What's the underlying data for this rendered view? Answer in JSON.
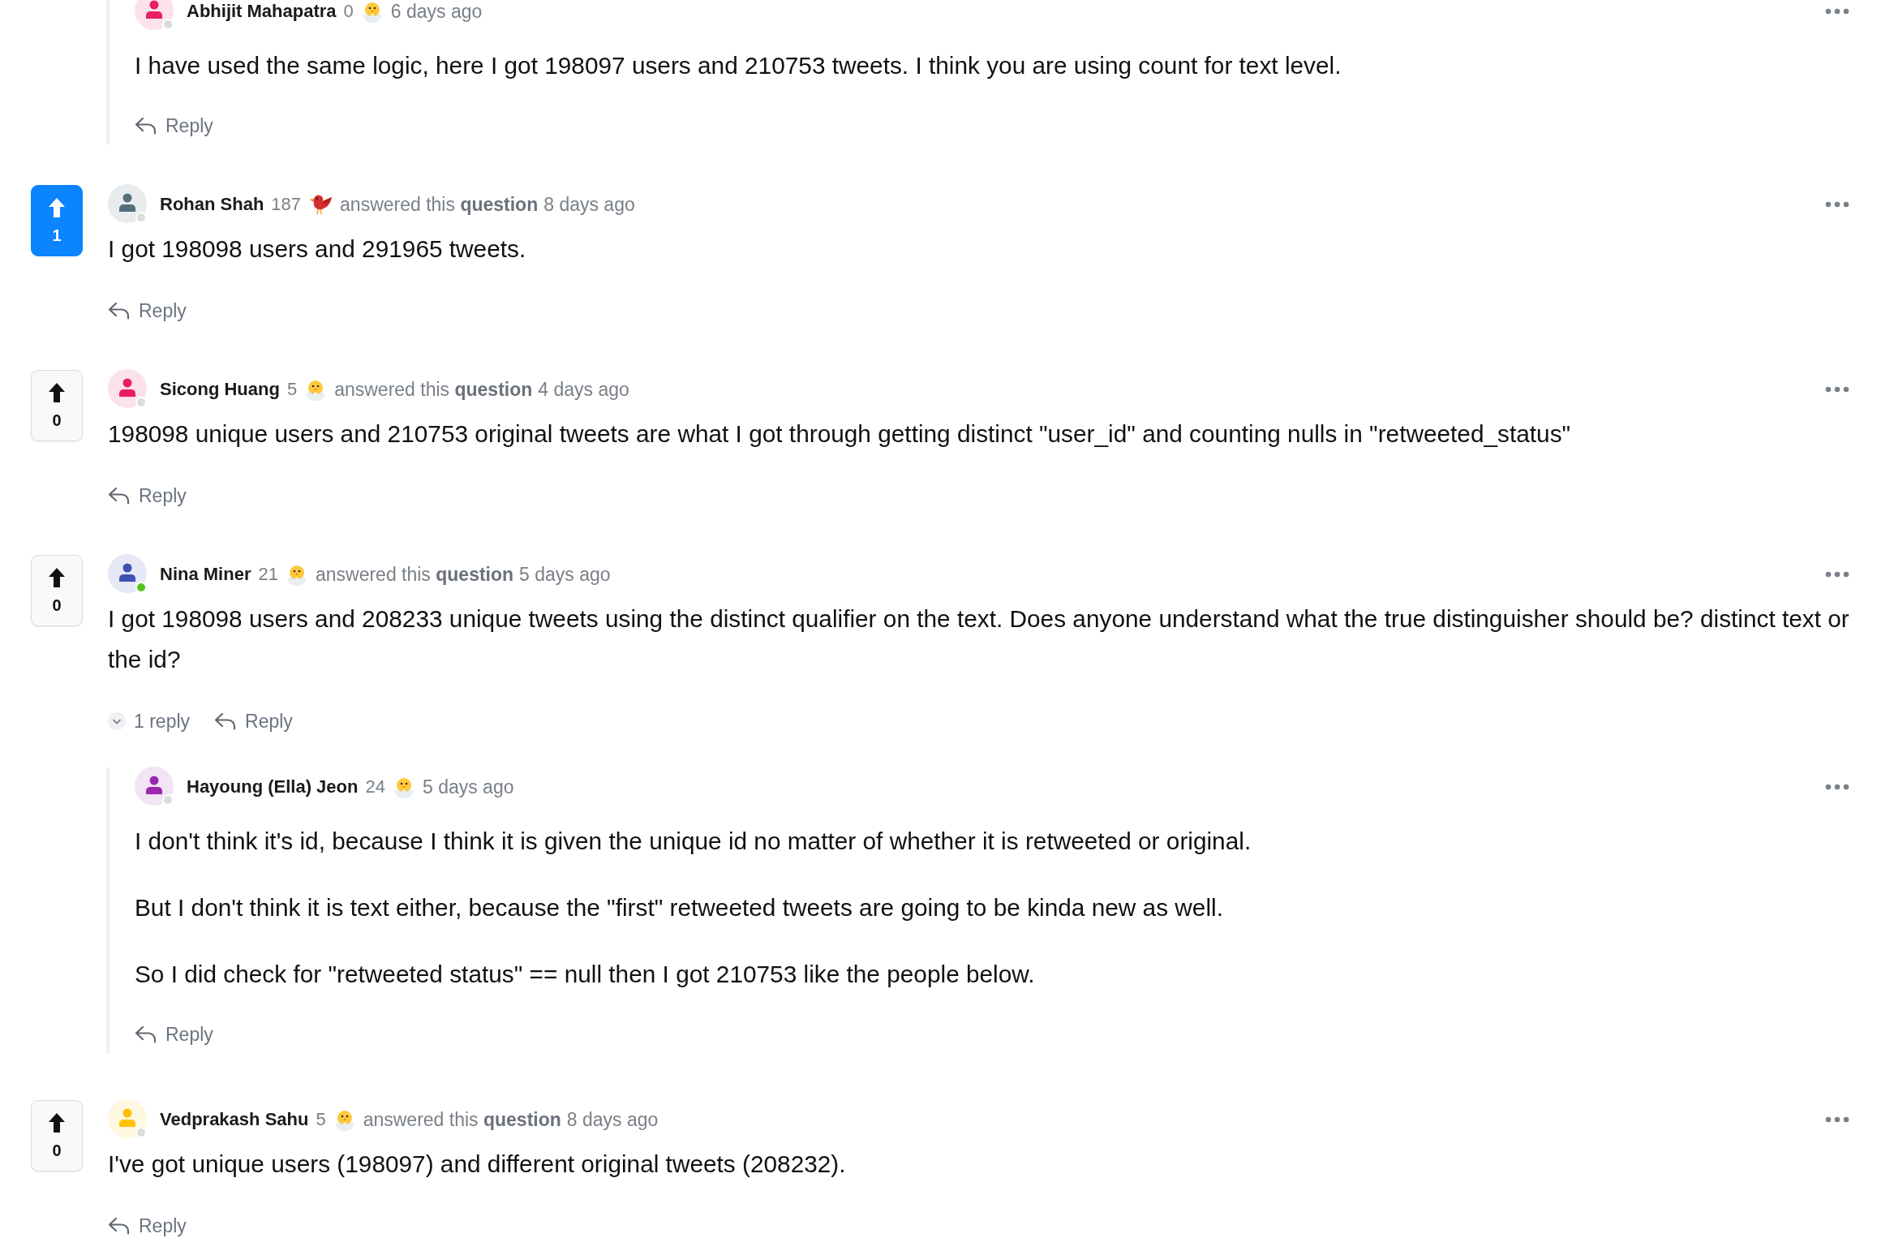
{
  "thread_continuation": {
    "replies": [
      {
        "author": {
          "name": "Abhijit Mahapatra",
          "score": "0",
          "badge": {
            "kind": "chick"
          },
          "avatar": {
            "color": "#e91e63",
            "online": false
          }
        },
        "time": "6 days ago",
        "paragraphs": [
          "I have used the same logic, here I got 198097 users and 210753 tweets. I think  you are using count for text level."
        ],
        "reply_label": "Reply"
      }
    ]
  },
  "answers": [
    {
      "votes": {
        "count": "1",
        "upvoted": true
      },
      "author": {
        "name": "Rohan Shah",
        "score": "187",
        "badge": {
          "kind": "bird"
        },
        "avatar": {
          "color": "#546e7a",
          "online": false
        }
      },
      "action": "answered this **question**",
      "time": "8 days ago",
      "paragraphs": [
        "I got 198098 users and 291965 tweets."
      ],
      "reply_label": "Reply"
    },
    {
      "votes": {
        "count": "0",
        "upvoted": false
      },
      "author": {
        "name": "Sicong Huang",
        "score": "5",
        "badge": {
          "kind": "chick"
        },
        "avatar": {
          "color": "#e91e63",
          "online": false
        }
      },
      "action": "answered this **question**",
      "time": "4 days ago",
      "paragraphs": [
        "198098 unique users and 210753 original tweets are what I got through getting distinct \"user_id\" and counting nulls in \"retweeted_status\""
      ],
      "reply_label": "Reply"
    },
    {
      "votes": {
        "count": "0",
        "upvoted": false
      },
      "author": {
        "name": "Nina Miner",
        "score": "21",
        "badge": {
          "kind": "chick"
        },
        "avatar": {
          "color": "#3f51b5",
          "online": true
        }
      },
      "action": "answered this **question**",
      "time": "5 days ago",
      "paragraphs": [
        "I got 198098 users and 208233 unique tweets using the distinct qualifier on the text. Does anyone understand what the true distinguisher should be? distinct text or the id?"
      ],
      "reply_toggle": {
        "label": "1 reply",
        "expanded": true
      },
      "reply_label": "Reply",
      "replies": [
        {
          "author": {
            "name": "Hayoung (Ella) Jeon",
            "score": "24",
            "badge": {
              "kind": "chick"
            },
            "avatar": {
              "color": "#9c27b0",
              "online": false
            }
          },
          "time": "5 days ago",
          "paragraphs": [
            "I don't think it's id, because I think it is given the unique id no matter of whether it is retweeted or original.",
            "But I don't think it is text either, because the \"first\" retweeted tweets are going to be kinda new as well.",
            "So I did check for \"retweeted status\" == null then I got 210753 like the people below."
          ],
          "reply_label": "Reply"
        }
      ]
    },
    {
      "votes": {
        "count": "0",
        "upvoted": false
      },
      "author": {
        "name": "Vedprakash Sahu",
        "score": "5",
        "badge": {
          "kind": "chick"
        },
        "avatar": {
          "color": "#ffc107",
          "online": false
        }
      },
      "action": "answered this **question**",
      "time": "8 days ago",
      "paragraphs": [
        "I've got unique users (198097) and different original tweets (208232)."
      ],
      "reply_label": "Reply"
    }
  ]
}
